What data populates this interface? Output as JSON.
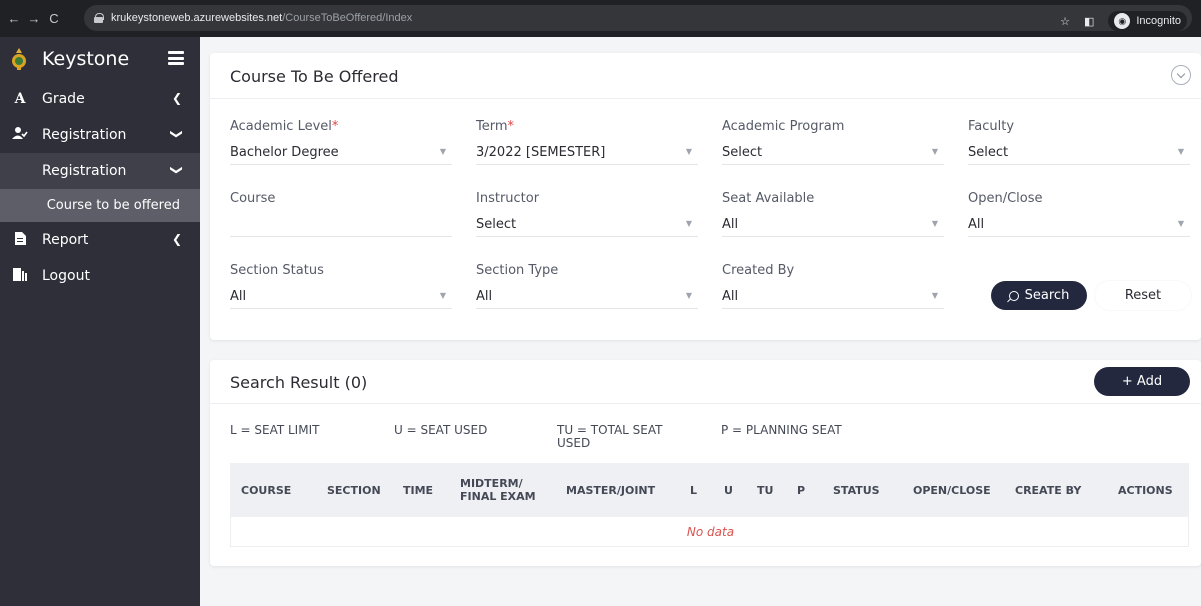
{
  "browser": {
    "url_host": "krukeystoneweb.azurewebsites.net",
    "url_path": "/CourseToBeOffered/Index",
    "incognito_label": "Incognito"
  },
  "sidebar": {
    "brand": "Keystone",
    "items": [
      {
        "label": "Grade",
        "icon": "A",
        "chevron": "❮"
      },
      {
        "label": "Registration",
        "icon": "person-check-icon",
        "chevron": "❯"
      },
      {
        "label": "Registration",
        "chevron": "❯"
      },
      {
        "label": "Course to be offered"
      },
      {
        "label": "Report",
        "icon": "document-icon",
        "chevron": "❮"
      },
      {
        "label": "Logout",
        "icon": "logout-icon"
      }
    ]
  },
  "filter": {
    "title": "Course To Be Offered",
    "fields": {
      "academic_level": {
        "label": "Academic Level",
        "required": "*",
        "value": "Bachelor Degree"
      },
      "term": {
        "label": "Term",
        "required": "*",
        "value": "3/2022 [SEMESTER]"
      },
      "academic_program": {
        "label": "Academic Program",
        "value": "Select"
      },
      "faculty": {
        "label": "Faculty",
        "value": "Select"
      },
      "course": {
        "label": "Course",
        "value": ""
      },
      "instructor": {
        "label": "Instructor",
        "value": "Select"
      },
      "seat_available": {
        "label": "Seat Available",
        "value": "All"
      },
      "open_close": {
        "label": "Open/Close",
        "value": "All"
      },
      "section_status": {
        "label": "Section Status",
        "value": "All"
      },
      "section_type": {
        "label": "Section Type",
        "value": "All"
      },
      "created_by": {
        "label": "Created By",
        "value": "All"
      }
    },
    "search_label": "Search",
    "reset_label": "Reset"
  },
  "results": {
    "title": "Search Result (0)",
    "add_label": "+ Add",
    "legend": {
      "l": "L = SEAT LIMIT",
      "u": "U = SEAT USED",
      "tu_line1": "TU = TOTAL SEAT",
      "tu_line2": "USED",
      "p": "P = PLANNING SEAT"
    },
    "columns": {
      "course": "COURSE",
      "section": "SECTION",
      "time": "TIME",
      "exam_line1": "MIDTERM/",
      "exam_line2": "FINAL EXAM",
      "master_joint": "MASTER/JOINT",
      "l": "L",
      "u": "U",
      "tu": "TU",
      "p": "P",
      "status": "STATUS",
      "open_close": "OPEN/CLOSE",
      "create_by": "CREATE BY",
      "actions": "ACTIONS"
    },
    "empty_text": "No data"
  },
  "colors": {
    "sidebar_bg": "#2f2f39",
    "primary_button": "#23283f",
    "required_mark": "#e04545",
    "no_data_text": "#d9534f"
  }
}
